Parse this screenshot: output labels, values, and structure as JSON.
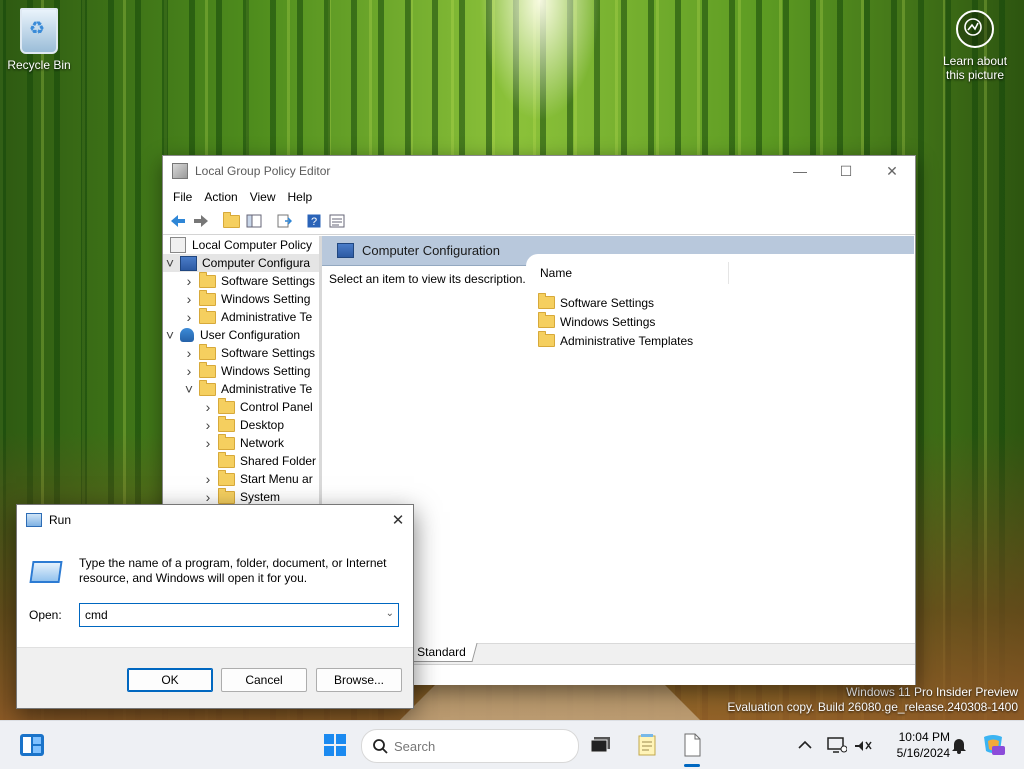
{
  "desktop": {
    "recycle_bin": "Recycle Bin",
    "learn_line1": "Learn about",
    "learn_line2": "this picture",
    "watermark_line1": "Windows 11 Pro Insider Preview",
    "watermark_line2": "Evaluation copy. Build 26080.ge_release.240308-1400"
  },
  "gpedit": {
    "title": "Local Group Policy Editor",
    "menu": [
      "File",
      "Action",
      "View",
      "Help"
    ],
    "tree": [
      {
        "label": "Local Computer Policy",
        "indent": 0,
        "icon": "root",
        "chevron": ""
      },
      {
        "label": "Computer Configura",
        "indent": 0,
        "icon": "computer",
        "chevron": "down",
        "selected": true
      },
      {
        "label": "Software Settings",
        "indent": 1,
        "icon": "folder",
        "chevron": "right"
      },
      {
        "label": "Windows Setting",
        "indent": 1,
        "icon": "folder",
        "chevron": "right"
      },
      {
        "label": "Administrative Te",
        "indent": 1,
        "icon": "folder",
        "chevron": "right"
      },
      {
        "label": "User Configuration",
        "indent": 0,
        "icon": "user",
        "chevron": "down"
      },
      {
        "label": "Software Settings",
        "indent": 1,
        "icon": "folder",
        "chevron": "right"
      },
      {
        "label": "Windows Setting",
        "indent": 1,
        "icon": "folder",
        "chevron": "right"
      },
      {
        "label": "Administrative Te",
        "indent": 1,
        "icon": "folder",
        "chevron": "down"
      },
      {
        "label": "Control Panel",
        "indent": 2,
        "icon": "folder",
        "chevron": "right"
      },
      {
        "label": "Desktop",
        "indent": 2,
        "icon": "folder",
        "chevron": "right"
      },
      {
        "label": "Network",
        "indent": 2,
        "icon": "folder",
        "chevron": "right"
      },
      {
        "label": "Shared Folder",
        "indent": 2,
        "icon": "folder",
        "chevron": ""
      },
      {
        "label": "Start Menu ar",
        "indent": 2,
        "icon": "folder",
        "chevron": "right"
      },
      {
        "label": "System",
        "indent": 2,
        "icon": "folder",
        "chevron": "right"
      }
    ],
    "header": "Computer Configuration",
    "description": "Select an item to view its description.",
    "column_name": "Name",
    "items": [
      "Software Settings",
      "Windows Settings",
      "Administrative Templates"
    ],
    "tab_standard": "Standard"
  },
  "run": {
    "title": "Run",
    "text": "Type the name of a program, folder, document, or Internet resource, and Windows will open it for you.",
    "open_label": "Open:",
    "open_value": "cmd",
    "ok": "OK",
    "cancel": "Cancel",
    "browse": "Browse..."
  },
  "taskbar": {
    "search_placeholder": "Search",
    "time": "10:04 PM",
    "date": "5/16/2024"
  },
  "colors": {
    "accent": "#0067c0",
    "header_band": "#b8c8dc",
    "folder": "#f5cf5f"
  }
}
